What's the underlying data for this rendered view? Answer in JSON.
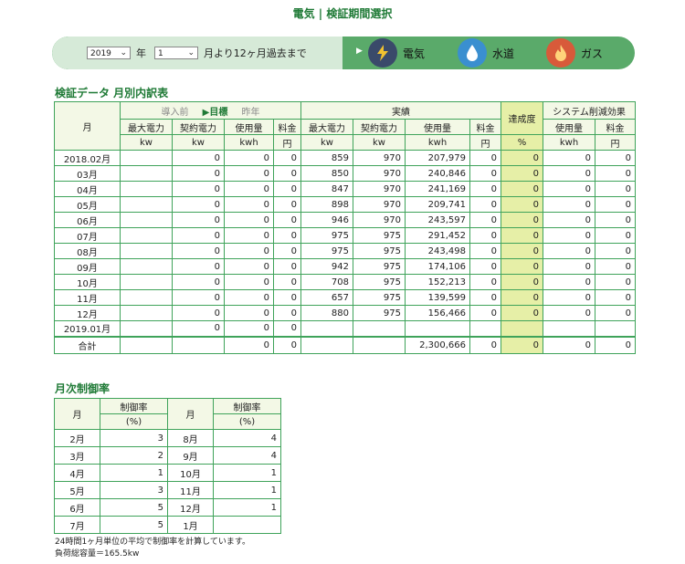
{
  "page_title": "電気 | 検証期間選択",
  "period_bar": {
    "year_value": "2019",
    "year_label": "年",
    "month_value": "1",
    "month_suffix": "月より12ヶ月過去まで",
    "utilities": [
      {
        "label": "電気",
        "icon": "lightning-icon",
        "color": "#3a4a6a"
      },
      {
        "label": "水道",
        "icon": "water-drop-icon",
        "color": "#3a8fd0"
      },
      {
        "label": "ガス",
        "icon": "flame-icon",
        "color": "#d85a3a"
      }
    ]
  },
  "monthly_section": {
    "title": "検証データ 月別内訳表",
    "header": {
      "month": "月",
      "compare_before": "導入前",
      "compare_target": "▶目標",
      "compare_last_year": "昨年",
      "actual": "実績",
      "achievement": "達成度",
      "reduction_effect": "システム削減効果",
      "max_power": "最大電力",
      "contract_power": "契約電力",
      "usage": "使用量",
      "fee": "料金",
      "unit_kw": "kw",
      "unit_kwh": "kwh",
      "unit_yen": "円",
      "unit_pct": "%"
    },
    "rows": [
      {
        "month": "2018.02月",
        "b_contract": "0",
        "b_usage": "0",
        "b_fee": "0",
        "a_max": "859",
        "a_contract": "970",
        "a_usage": "207,979",
        "a_fee": "0",
        "ach": "0",
        "r_usage": "0",
        "r_fee": "0"
      },
      {
        "month": "03月",
        "b_contract": "0",
        "b_usage": "0",
        "b_fee": "0",
        "a_max": "850",
        "a_contract": "970",
        "a_usage": "240,846",
        "a_fee": "0",
        "ach": "0",
        "r_usage": "0",
        "r_fee": "0"
      },
      {
        "month": "04月",
        "b_contract": "0",
        "b_usage": "0",
        "b_fee": "0",
        "a_max": "847",
        "a_contract": "970",
        "a_usage": "241,169",
        "a_fee": "0",
        "ach": "0",
        "r_usage": "0",
        "r_fee": "0"
      },
      {
        "month": "05月",
        "b_contract": "0",
        "b_usage": "0",
        "b_fee": "0",
        "a_max": "898",
        "a_contract": "970",
        "a_usage": "209,741",
        "a_fee": "0",
        "ach": "0",
        "r_usage": "0",
        "r_fee": "0"
      },
      {
        "month": "06月",
        "b_contract": "0",
        "b_usage": "0",
        "b_fee": "0",
        "a_max": "946",
        "a_contract": "970",
        "a_usage": "243,597",
        "a_fee": "0",
        "ach": "0",
        "r_usage": "0",
        "r_fee": "0"
      },
      {
        "month": "07月",
        "b_contract": "0",
        "b_usage": "0",
        "b_fee": "0",
        "a_max": "975",
        "a_contract": "975",
        "a_usage": "291,452",
        "a_fee": "0",
        "ach": "0",
        "r_usage": "0",
        "r_fee": "0"
      },
      {
        "month": "08月",
        "b_contract": "0",
        "b_usage": "0",
        "b_fee": "0",
        "a_max": "975",
        "a_contract": "975",
        "a_usage": "243,498",
        "a_fee": "0",
        "ach": "0",
        "r_usage": "0",
        "r_fee": "0"
      },
      {
        "month": "09月",
        "b_contract": "0",
        "b_usage": "0",
        "b_fee": "0",
        "a_max": "942",
        "a_contract": "975",
        "a_usage": "174,106",
        "a_fee": "0",
        "ach": "0",
        "r_usage": "0",
        "r_fee": "0"
      },
      {
        "month": "10月",
        "b_contract": "0",
        "b_usage": "0",
        "b_fee": "0",
        "a_max": "708",
        "a_contract": "975",
        "a_usage": "152,213",
        "a_fee": "0",
        "ach": "0",
        "r_usage": "0",
        "r_fee": "0"
      },
      {
        "month": "11月",
        "b_contract": "0",
        "b_usage": "0",
        "b_fee": "0",
        "a_max": "657",
        "a_contract": "975",
        "a_usage": "139,599",
        "a_fee": "0",
        "ach": "0",
        "r_usage": "0",
        "r_fee": "0"
      },
      {
        "month": "12月",
        "b_contract": "0",
        "b_usage": "0",
        "b_fee": "0",
        "a_max": "880",
        "a_contract": "975",
        "a_usage": "156,466",
        "a_fee": "0",
        "ach": "0",
        "r_usage": "0",
        "r_fee": "0"
      },
      {
        "month": "2019.01月",
        "b_contract": "0",
        "b_usage": "0",
        "b_fee": "0",
        "a_max": "",
        "a_contract": "",
        "a_usage": "",
        "a_fee": "",
        "ach": "",
        "r_usage": "",
        "r_fee": ""
      }
    ],
    "total": {
      "label": "合計",
      "b_usage": "0",
      "b_fee": "0",
      "a_usage": "2,300,666",
      "a_fee": "0",
      "ach": "0",
      "r_usage": "0",
      "r_fee": "0"
    }
  },
  "control_section": {
    "title": "月次制御率",
    "header": {
      "month": "月",
      "rate": "制御率",
      "unit": "(%)"
    },
    "rows": [
      {
        "m1": "2月",
        "v1": "3",
        "m2": "8月",
        "v2": "4"
      },
      {
        "m1": "3月",
        "v1": "2",
        "m2": "9月",
        "v2": "4"
      },
      {
        "m1": "4月",
        "v1": "1",
        "m2": "10月",
        "v2": "1"
      },
      {
        "m1": "5月",
        "v1": "3",
        "m2": "11月",
        "v2": "1"
      },
      {
        "m1": "6月",
        "v1": "5",
        "m2": "12月",
        "v2": "1"
      },
      {
        "m1": "7月",
        "v1": "5",
        "m2": "1月",
        "v2": ""
      }
    ]
  },
  "notes": {
    "line1": "24時間1ヶ月単位の平均で制御率を計算しています。",
    "line2": "負荷総容量＝165.5kw"
  }
}
